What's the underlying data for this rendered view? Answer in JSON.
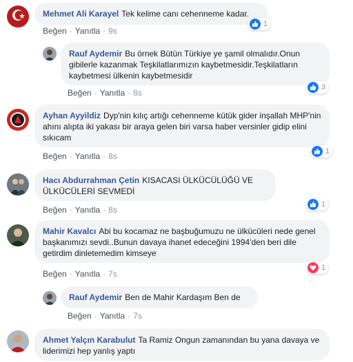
{
  "actions": {
    "like": "Beğen",
    "reply": "Yanıtla",
    "dot": "·"
  },
  "colors": {
    "like_blue": "#1877f2",
    "love_red": "#f33e58",
    "author": "#385898"
  },
  "comments": [
    {
      "author": "Mehmet Ali Karayel",
      "text": "Tek kelime canı cehenneme kadar.",
      "time": "9s",
      "reaction_icon": "like-icon",
      "reaction_count": "1"
    },
    {
      "author": "Rauf Aydemir",
      "text": "Bu örnek Bütün Türkiye ye şamil olmalıdır.Onun gibilerle kazanmak Teşkilatlarımızın kaybetmesidir.Teşkilatların kaybetmesi ülkenin kaybetmesidir",
      "time": "8s",
      "reaction_icon": "like-icon",
      "reaction_count": "3"
    },
    {
      "author": "Ayhan Ayyildiz",
      "text": "Dyp'nin kılıç artığı cehenneme kütük gider inşallah MHP'nin ahını alıpta iki yakası bir araya gelen biri varsa haber versinler gidip elini sıkıcam",
      "time": "8s",
      "reaction_icon": "like-icon",
      "reaction_count": "1"
    },
    {
      "author": "Hacı Abdurrahman Çetin",
      "text": "KISACASI ÜLKÜCÜLÜĞÜ VE ÜLKÜCÜLERİ SEVMEDİ",
      "time": "8s",
      "reaction_icon": "like-icon",
      "reaction_count": "1"
    },
    {
      "author": "Mahir Kavalcı",
      "text": "Abi bu kocamaz ne başbuğumuzu ne ülkücüleri nede genel başkanımızı sevdi..Bunun davaya ihanet edeceğini 1994'den beri dile getirdim dinletemedim kimseye",
      "time": "7s",
      "reaction_icon": "love-icon",
      "reaction_count": "1"
    },
    {
      "author": "Rauf Aydemir",
      "text": "Ben de Mahir Kardaşım Ben de",
      "time": "7s"
    },
    {
      "author": "Ahmet Yalçın Karabulut",
      "text": "Ta Ramiz Ongun zamanından bu yana davaya ve liderimizi hep yanlış yaptı"
    }
  ]
}
